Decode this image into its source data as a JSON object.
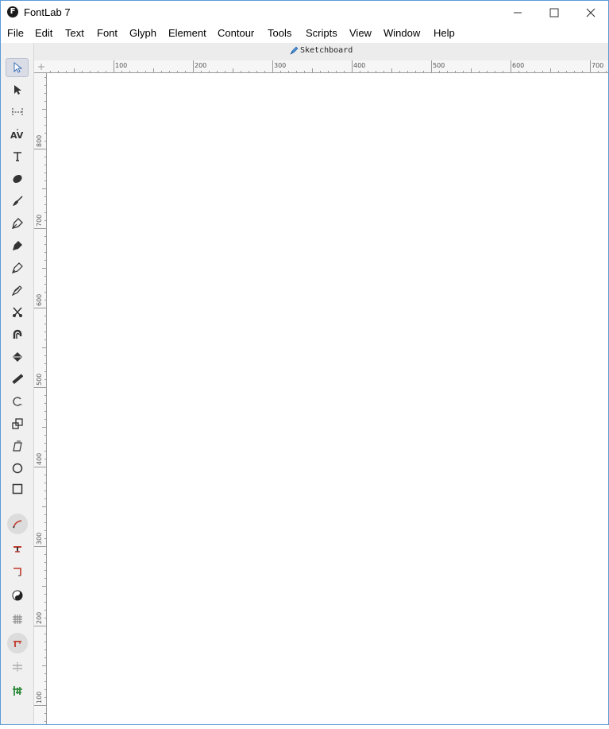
{
  "app": {
    "title": "FontLab 7",
    "logo_letter": "F"
  },
  "menu": [
    "File",
    "Edit",
    "Text",
    "Font",
    "Glyph",
    "Element",
    "Contour",
    "Tools",
    "Scripts",
    "View",
    "Window",
    "Help"
  ],
  "tab": {
    "label": "Sketchboard"
  },
  "ruler": {
    "horizontal_labels": [
      "100",
      "200",
      "300",
      "400",
      "500",
      "600",
      "700"
    ],
    "vertical_labels": [
      "800",
      "700",
      "600",
      "500",
      "400",
      "300",
      "200",
      "100"
    ]
  },
  "tools": [
    "select-icon",
    "contour-select-icon",
    "metrics-icon",
    "kerning-icon",
    "text-icon",
    "eraser-icon",
    "brush-icon",
    "pen-icon",
    "rapidograph-icon",
    "pencil-icon",
    "knife-icon",
    "scissors-icon",
    "magnet-icon",
    "fill-icon",
    "measure-icon",
    "rotate-icon",
    "scale-icon",
    "slant-icon",
    "ellipse-icon",
    "rectangle-icon",
    "curve-icon",
    "tangent-icon",
    "corner-icon",
    "yin-yang-icon",
    "grid-icon",
    "red-corner-icon",
    "align-icon",
    "green-sparkle-icon"
  ]
}
